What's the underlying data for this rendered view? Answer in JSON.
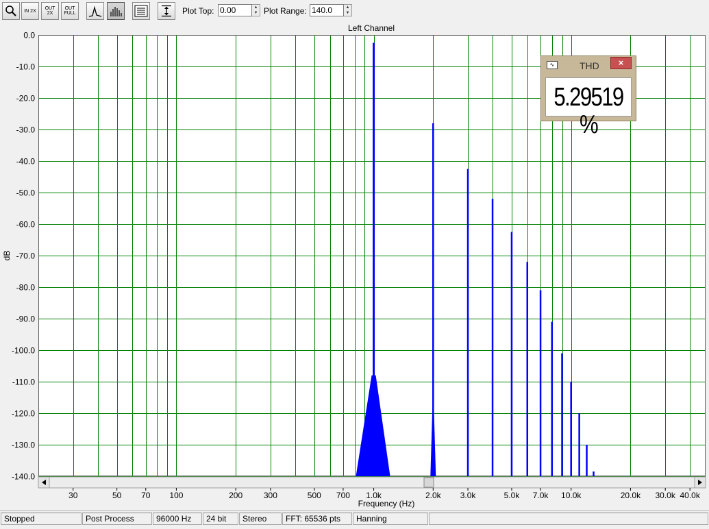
{
  "toolbar": {
    "buttons": [
      {
        "name": "zoom-tool-button",
        "icon": "magnifier-icon",
        "label": ""
      },
      {
        "name": "zoom-in-2x-button",
        "icon": "zoom-in-icon",
        "label": "IN 2X"
      },
      {
        "name": "zoom-out-2x-button",
        "icon": "zoom-out-icon",
        "label": "OUT 2X"
      },
      {
        "name": "zoom-out-full-button",
        "icon": "zoom-full-icon",
        "label": "OUT FULL"
      },
      {
        "name": "line-graph-button",
        "icon": "line-graph-icon",
        "label": ""
      },
      {
        "name": "bar-graph-button",
        "icon": "bar-graph-icon",
        "label": ""
      },
      {
        "name": "panel-button",
        "icon": "panel-icon",
        "label": ""
      },
      {
        "name": "vertical-range-button",
        "icon": "vertical-range-icon",
        "label": ""
      }
    ],
    "plot_top_label": "Plot Top:",
    "plot_top_value": "0.00",
    "plot_range_label": "Plot Range:",
    "plot_range_value": "140.0"
  },
  "thd_window": {
    "title": "THD",
    "close_label": "×",
    "value": "5.29519 %"
  },
  "status_bar": {
    "state": "Stopped",
    "mode": "Post Process",
    "sample_rate": "96000 Hz",
    "bit_depth": "24 bit",
    "channels": "Stereo",
    "fft": "FFT: 65536 pts",
    "window": "Hanning"
  },
  "colors": {
    "plot_bg": "#ffffff",
    "grid": "#008000",
    "trace": "#0000ff"
  },
  "chart_data": {
    "type": "bar",
    "title": "Left Channel",
    "xlabel": "Frequency (Hz)",
    "ylabel": "dB",
    "x_scale": "log",
    "xlim": [
      20,
      48000
    ],
    "ylim": [
      -140,
      0
    ],
    "y_ticks": [
      "0.0",
      "-10.0",
      "-20.0",
      "-30.0",
      "-40.0",
      "-50.0",
      "-60.0",
      "-70.0",
      "-80.0",
      "-90.0",
      "-100.0",
      "-110.0",
      "-120.0",
      "-130.0",
      "-140.0"
    ],
    "x_tick_labels": [
      {
        "value": 30,
        "label": "30"
      },
      {
        "value": 50,
        "label": "50"
      },
      {
        "value": 70,
        "label": "70"
      },
      {
        "value": 100,
        "label": "100"
      },
      {
        "value": 200,
        "label": "200"
      },
      {
        "value": 300,
        "label": "300"
      },
      {
        "value": 500,
        "label": "500"
      },
      {
        "value": 700,
        "label": "700"
      },
      {
        "value": 1000,
        "label": "1.0k"
      },
      {
        "value": 2000,
        "label": "2.0k"
      },
      {
        "value": 3000,
        "label": "3.0k"
      },
      {
        "value": 5000,
        "label": "5.0k"
      },
      {
        "value": 7000,
        "label": "7.0k"
      },
      {
        "value": 10000,
        "label": "10.0k"
      },
      {
        "value": 20000,
        "label": "20.0k"
      },
      {
        "value": 30000,
        "label": "30.0k"
      },
      {
        "value": 40000,
        "label": "40.0k"
      }
    ],
    "grid": true,
    "series": [
      {
        "peaks": [
          {
            "x": 1000,
            "y": -2.5
          },
          {
            "x": 2000,
            "y": -28
          },
          {
            "x": 3000,
            "y": -42.5
          },
          {
            "x": 4000,
            "y": -52
          },
          {
            "x": 5000,
            "y": -62.5
          },
          {
            "x": 6000,
            "y": -72
          },
          {
            "x": 7000,
            "y": -81
          },
          {
            "x": 8000,
            "y": -91
          },
          {
            "x": 9000,
            "y": -101
          },
          {
            "x": 10000,
            "y": -110
          },
          {
            "x": 11000,
            "y": -120
          },
          {
            "x": 12000,
            "y": -130
          },
          {
            "x": 13000,
            "y": -138.5
          }
        ]
      }
    ]
  }
}
